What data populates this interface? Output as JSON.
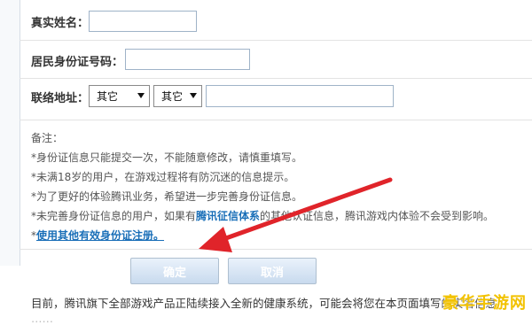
{
  "form": {
    "real_name_label": "真实姓名：",
    "real_name_value": "",
    "id_number_label": "居民身份证号码：",
    "id_number_value": "",
    "address_label": "联络地址：",
    "province_select": "其它",
    "city_select": "其它",
    "address_value": ""
  },
  "notes": {
    "title": "备注：",
    "line1": "*身份证信息只能提交一次，不能随意修改，请慎重填写。",
    "line2": "*未满18岁的用户，在游戏过程将有防沉迷的信息提示。",
    "line3": "*为了更好的体验腾讯业务，希望进一步完善身份证信息。",
    "line4_prefix": "*未完善身份证信息的用户，如果有",
    "line4_link": "腾讯征信体系",
    "line4_suffix": "的其他认证信息，腾讯游戏内体验不会受到影响。",
    "line5_prefix": "*",
    "line5_link": "使用其他有效身份证注册。"
  },
  "buttons": {
    "confirm": "确定",
    "cancel": "取消"
  },
  "footer": {
    "line1": "目前，腾讯旗下全部游戏产品正陆续接入全新的健康系统，可能会将您在本页面填写的实名信息",
    "line2": "……"
  },
  "watermark": "豪华手游网",
  "colors": {
    "accent_link": "#1a6fb8",
    "annotation_arrow": "#e0242a",
    "button_gradient_top": "#eaf2fb",
    "button_gradient_bottom": "#c8daee"
  }
}
